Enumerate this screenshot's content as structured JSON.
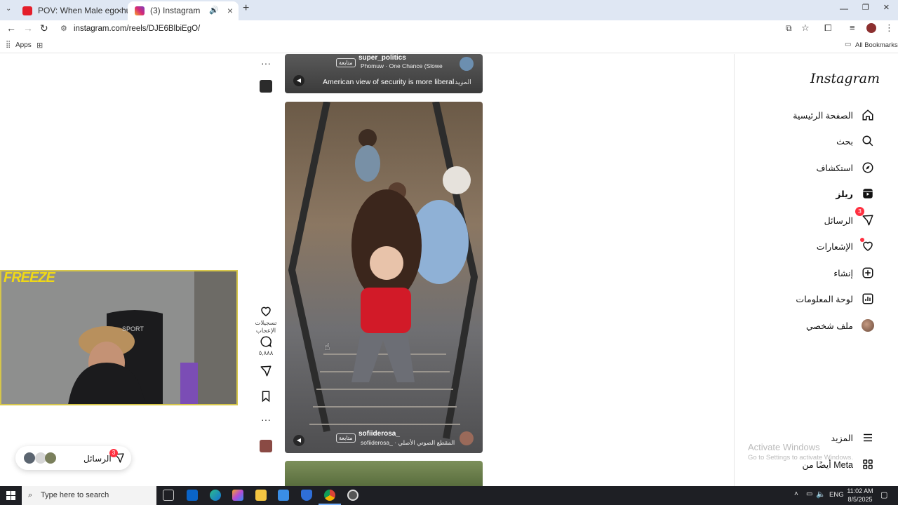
{
  "browser": {
    "tabs": [
      {
        "title": "POV: When Male ego hurts #m",
        "favicon_color": "#e41e2a",
        "active": false
      },
      {
        "title": "(3) Instagram",
        "favicon_color": "#d62976",
        "active": true
      }
    ],
    "new_tab": "+",
    "url": "instagram.com/reels/DJE6BlbiEgO/",
    "bookmarks": {
      "apps_label": "Apps",
      "all_bookmarks_label": "All Bookmarks"
    }
  },
  "instagram": {
    "logo": "Instagram",
    "nav": [
      {
        "label": "الصفحة الرئيسية",
        "icon": "home-icon"
      },
      {
        "label": "بحث",
        "icon": "search-icon"
      },
      {
        "label": "استكشاف",
        "icon": "compass-icon"
      },
      {
        "label": "ريلز",
        "icon": "reels-icon",
        "active": true
      },
      {
        "label": "الرسائل",
        "icon": "messenger-icon",
        "badge": "3"
      },
      {
        "label": "الإشعارات",
        "icon": "heart-icon"
      },
      {
        "label": "إنشاء",
        "icon": "plus-square-icon"
      },
      {
        "label": "لوحة المعلومات",
        "icon": "dashboard-icon"
      },
      {
        "label": "ملف شخصي",
        "icon": "avatar"
      }
    ],
    "more_label": "المزيد",
    "meta_label": "أيضًا من Meta",
    "reel_top": {
      "username": "super_politics",
      "follow_label": "متابعة",
      "audio": "Phomuw · One Chance (Slowe",
      "caption": "American view of security is more liberal ...",
      "more_label": "المزيد"
    },
    "reel_main": {
      "username": "sofiiderosa_",
      "follow_label": "متابعة",
      "audio": "sofiiderosa_ · المقطع الصوتي الأصلي"
    },
    "actions": {
      "likes_label": "تسجيلات الإعجاب",
      "comments_count": "٥,٨٨٨"
    },
    "messages_pill": {
      "label": "الرسائل",
      "badge": "3"
    }
  },
  "webcam": {
    "overlay_text": "FREEZE",
    "chair_text": "SPORT"
  },
  "watermark": {
    "title": "Activate Windows",
    "subtitle": "Go to Settings to activate Windows."
  },
  "taskbar": {
    "search_placeholder": "Type here to search",
    "language": "ENG",
    "time": "11:02 AM",
    "date": "8/5/2025"
  },
  "colors": {
    "accent": "#ff3040",
    "tab_strip": "#dfe7f3",
    "taskbar": "#1e1f24"
  }
}
